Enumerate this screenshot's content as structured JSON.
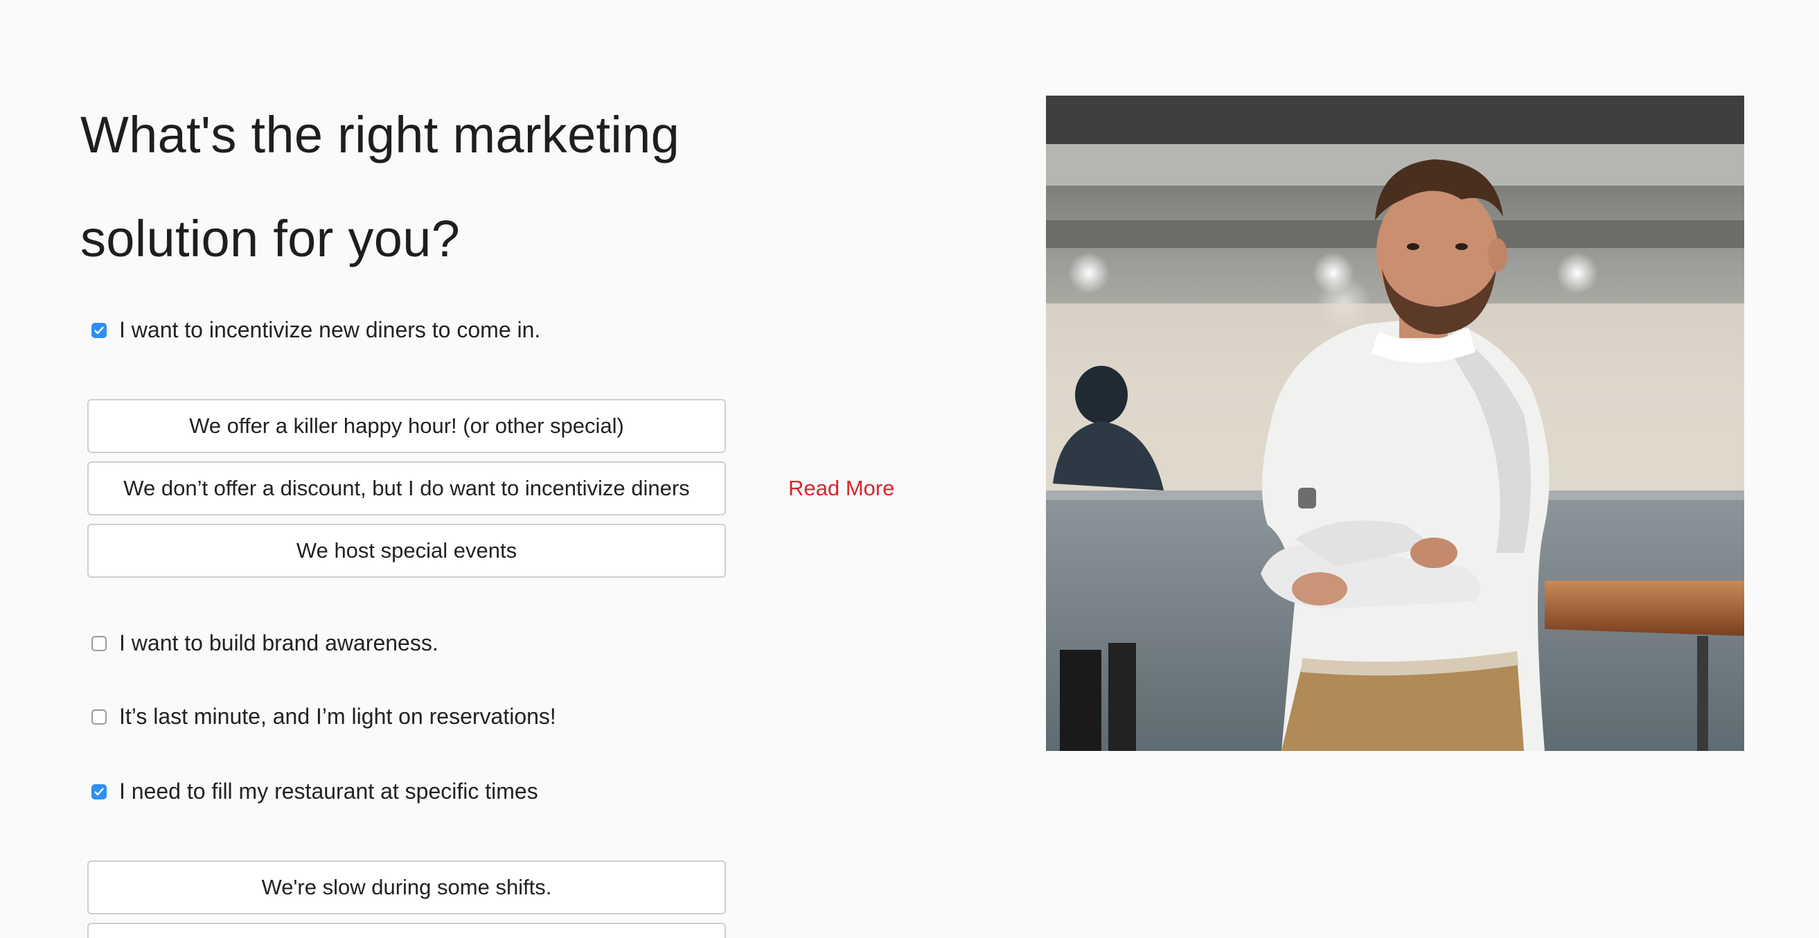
{
  "heading": {
    "line1": "What's the right marketing",
    "line2": "solution for you?"
  },
  "options": {
    "incentivize": {
      "label": "I want to incentivize new diners to come in.",
      "checked": true
    },
    "brand": {
      "label": "I want to build brand awareness.",
      "checked": false
    },
    "last_minute": {
      "label": "It’s last minute, and I’m light on reservations!",
      "checked": false
    },
    "fill_times": {
      "label": "I need to fill my restaurant at specific times",
      "checked": true
    }
  },
  "incentivize_buttons": [
    {
      "label": "We offer a killer happy hour! (or other special)"
    },
    {
      "label": "We don’t offer a discount, but I do want to incentivize diners"
    },
    {
      "label": "We host special events"
    }
  ],
  "read_more": "Read More",
  "fill_times_buttons": [
    {
      "label": "We're slow during some shifts."
    }
  ],
  "colors": {
    "accent_blue": "#2f8ef4",
    "link_red": "#d6262c",
    "border": "#cfcfcf"
  },
  "icons": {
    "checkbox_checked": "checkmark-icon"
  }
}
